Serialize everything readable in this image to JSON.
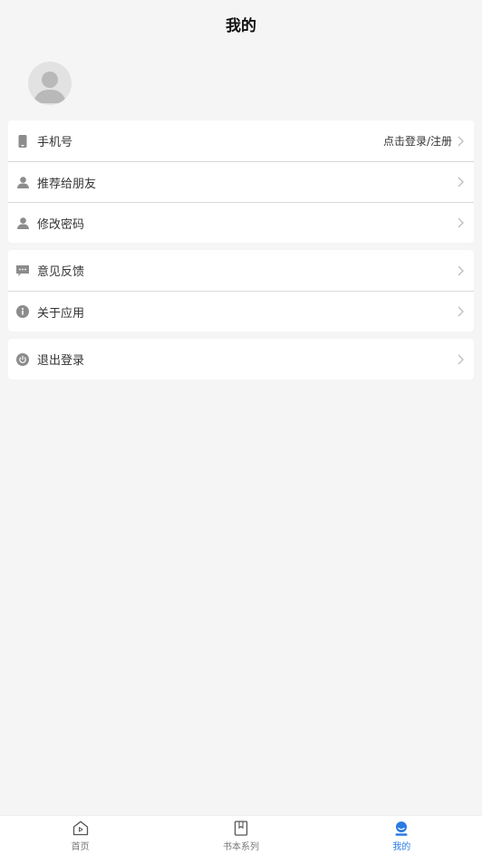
{
  "header": {
    "title": "我的"
  },
  "menu_groups": [
    {
      "items": [
        {
          "icon": "phone-icon",
          "label": "手机号",
          "value": "点击登录/注册"
        },
        {
          "icon": "user-icon",
          "label": "推荐给朋友",
          "value": ""
        },
        {
          "icon": "user-icon",
          "label": "修改密码",
          "value": ""
        }
      ]
    },
    {
      "items": [
        {
          "icon": "feedback-icon",
          "label": "意见反馈",
          "value": ""
        },
        {
          "icon": "info-icon",
          "label": "关于应用",
          "value": ""
        }
      ]
    },
    {
      "items": [
        {
          "icon": "power-icon",
          "label": "退出登录",
          "value": ""
        }
      ]
    }
  ],
  "tabbar": {
    "tabs": [
      {
        "icon": "home-icon",
        "label": "首页",
        "active": false
      },
      {
        "icon": "bookmark-book-icon",
        "label": "书本系列",
        "active": false
      },
      {
        "icon": "profile-icon",
        "label": "我的",
        "active": true
      }
    ]
  },
  "colors": {
    "background": "#f5f5f5",
    "card": "#ffffff",
    "accent": "#2a7be4",
    "icon_gray": "#8c8c8c",
    "chevron": "#bbbbbb"
  }
}
